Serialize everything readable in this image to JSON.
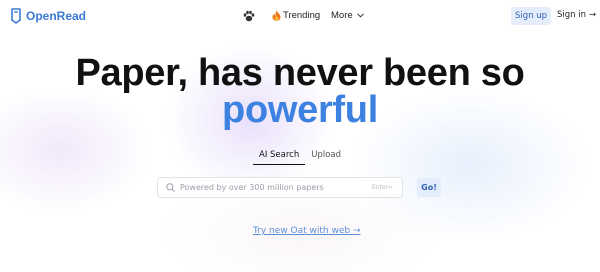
{
  "header": {
    "logo_text": "OpenRead",
    "nav_icon": "paw-icon",
    "trending_label": "Trending",
    "trending_icon": "fire-icon",
    "more_label": "More",
    "signup_label": "Sign up",
    "signin_label": "Sign in",
    "signin_arrow": "→"
  },
  "hero": {
    "line1": "Paper, has never been so",
    "line2": "powerful"
  },
  "tabs": [
    {
      "label": "AI Search",
      "active": true
    },
    {
      "label": "Upload",
      "active": false
    }
  ],
  "search": {
    "placeholder": "Powered by over 300 million papers",
    "enter_hint": "Enter↵",
    "go_label": "Go!"
  },
  "footer_link": {
    "label": "Try new Oat with web →"
  },
  "colors": {
    "accent": "#3d82e0",
    "button_bg": "#e4edfb",
    "link": "#5a8fd8"
  }
}
